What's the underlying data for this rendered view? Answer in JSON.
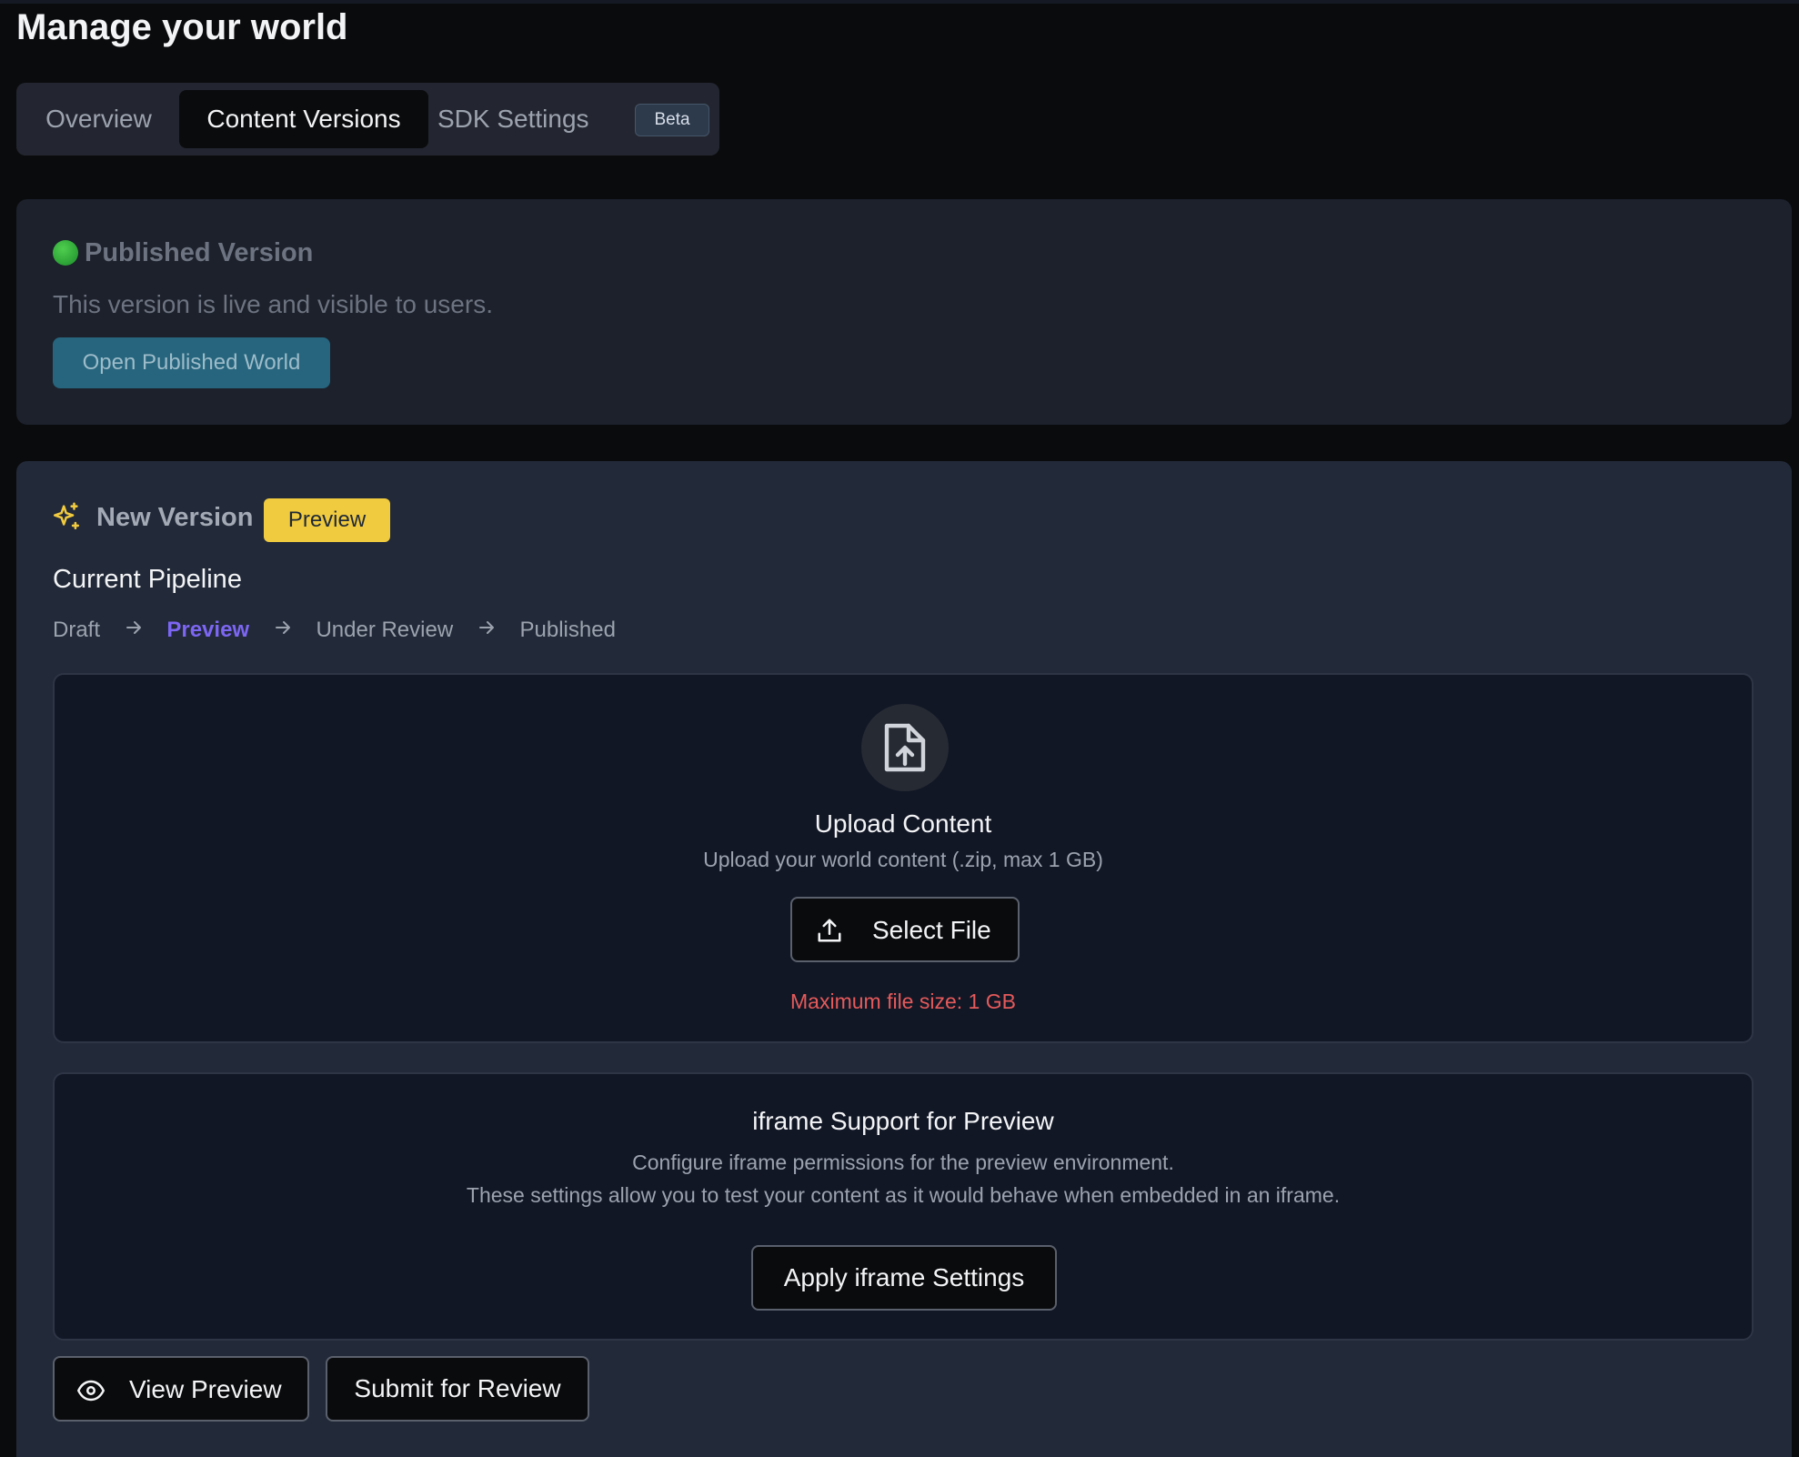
{
  "page": {
    "title": "Manage your world"
  },
  "tabs": [
    {
      "label": "Overview",
      "active": false
    },
    {
      "label": "Content Versions",
      "active": true
    },
    {
      "label": "SDK Settings",
      "active": false,
      "badge": "Beta"
    }
  ],
  "published": {
    "status_icon": "green-circle",
    "title": "Published Version",
    "description": "This version is live and visible to users.",
    "button_label": "Open Published World"
  },
  "new_version": {
    "icon": "sparkles-icon",
    "title": "New Version",
    "badge": "Preview",
    "pipeline_title": "Current Pipeline",
    "pipeline": [
      "Draft",
      "Preview",
      "Under Review",
      "Published"
    ],
    "pipeline_current": "Preview",
    "upload": {
      "icon": "file-upload-icon",
      "title": "Upload Content",
      "description": "Upload your world content (.zip, max 1 GB)",
      "button_label": "Select File",
      "max_size_text": "Maximum file size: 1 GB"
    },
    "iframe": {
      "title": "iframe Support for Preview",
      "description_line1": "Configure iframe permissions for the preview environment.",
      "description_line2": "These settings allow you to test your content as it would behave when embedded in an iframe.",
      "button_label": "Apply iframe Settings"
    },
    "actions": {
      "view_preview_label": "View Preview",
      "submit_label": "Submit for Review"
    }
  },
  "colors": {
    "background": "#0a0b0d",
    "card": "#222938",
    "accent_purple": "#7c66f2",
    "badge_yellow": "#f0ca3f",
    "error_red": "#e55a5a",
    "published_button": "#26657d"
  }
}
